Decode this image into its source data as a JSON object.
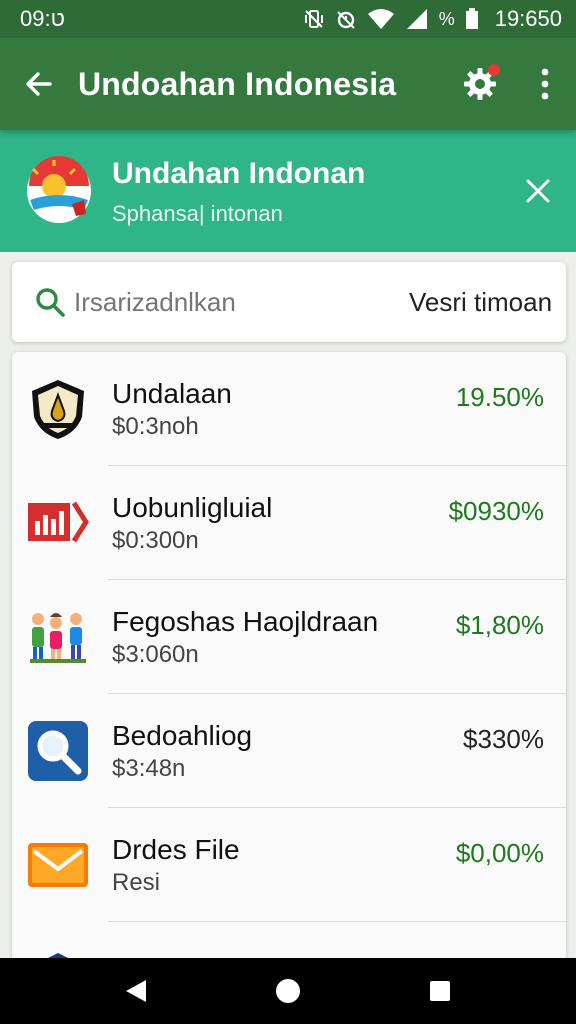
{
  "status_bar": {
    "time": "ט:09",
    "battery_text": "%",
    "right_time": "19:650",
    "icons": [
      "vibrate-icon",
      "alarm-icon",
      "wifi-icon",
      "signal-icon",
      "battery-icon"
    ]
  },
  "app_bar": {
    "title": "Undoahan Indonesia",
    "back_icon": "arrow-left-icon",
    "settings_icon": "gear-icon",
    "more_icon": "more-vert-icon"
  },
  "banner": {
    "title": "Undahan Indonan",
    "subtitle": "Sphansa| intonan",
    "close_icon": "close-icon"
  },
  "search": {
    "placeholder": "Irsarizadnlkan",
    "right_label": "Vesri timoan"
  },
  "items": [
    {
      "title": "Undalaan",
      "subtitle": "$0:3noh",
      "value": "19.50%",
      "value_color": "#1d7a1d",
      "icon": "shield-emblem-icon"
    },
    {
      "title": "Uobunligluial",
      "subtitle": "$0:300n",
      "value": "$0930%",
      "value_color": "#1d7a1d",
      "icon": "chart-tag-icon"
    },
    {
      "title": "Fegoshas Haojldraan",
      "subtitle": "$3:060n",
      "value": "$1,80%",
      "value_color": "#1d7a1d",
      "icon": "people-icon"
    },
    {
      "title": "Bedoahliog",
      "subtitle": "$3:48n",
      "value": "$330%",
      "value_color": "#222222",
      "icon": "magnifier-icon"
    },
    {
      "title": "Drdes File",
      "subtitle": "Resi",
      "value": "$0,00%",
      "value_color": "#1d7a1d",
      "icon": "envelope-icon"
    }
  ],
  "nav": {
    "back_icon": "nav-back-icon",
    "home_icon": "nav-home-icon",
    "recents_icon": "nav-recents-icon"
  },
  "colors": {
    "status_bar": "#2e6b37",
    "app_bar": "#35793e",
    "banner": "#2fb587",
    "positive": "#1d7a1d"
  }
}
